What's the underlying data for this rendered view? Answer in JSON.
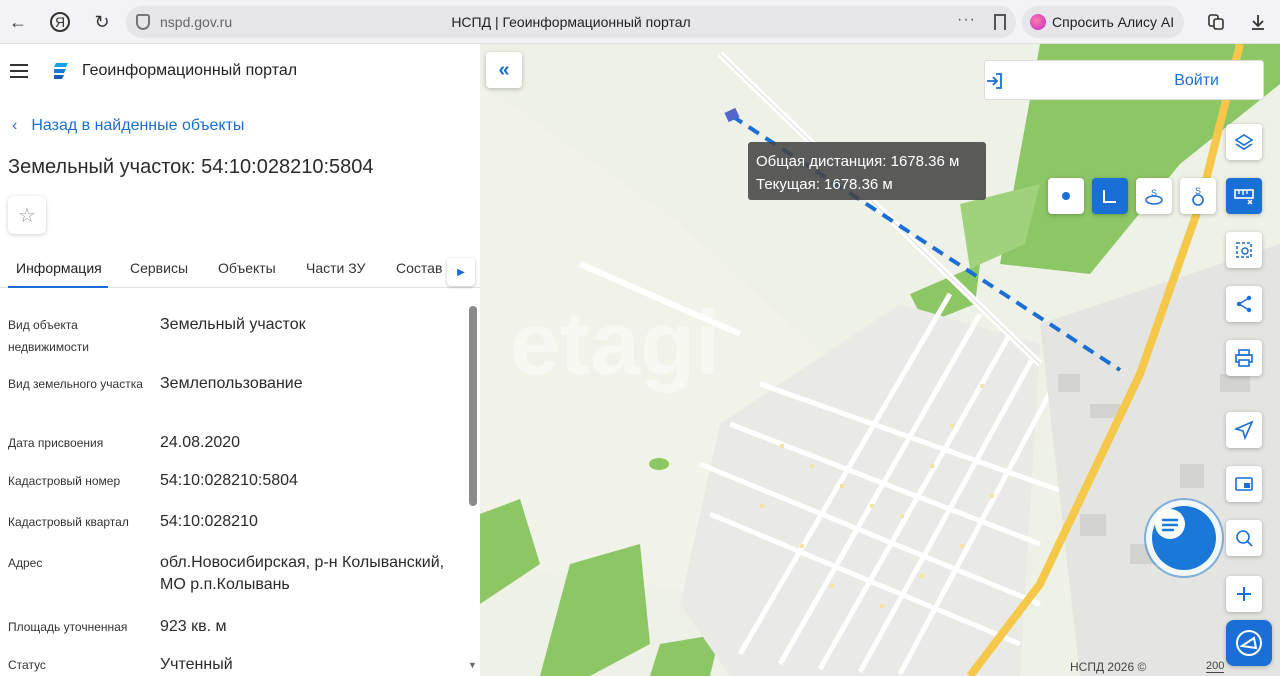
{
  "browser": {
    "host": "nspd.gov.ru",
    "page_title": "НСПД | Геоинформационный портал",
    "alice_label": "Спросить Алису AI",
    "dots": "···"
  },
  "panel": {
    "portal_name": "Геоинформационный портал",
    "back_label": "Назад в найденные объекты",
    "object_title": "Земельный участок: 54:10:028210:5804",
    "tabs": [
      "Информация",
      "Сервисы",
      "Объекты",
      "Части ЗУ",
      "Состав"
    ],
    "fields": [
      {
        "label": "Вид объекта недвижимости",
        "value": "Земельный участок"
      },
      {
        "label": "Вид земельного участка",
        "value": "Землепользование"
      },
      {
        "label": "Дата присвоения",
        "value": "24.08.2020"
      },
      {
        "label": "Кадастровый номер",
        "value": "54:10:028210:5804"
      },
      {
        "label": "Кадастровый квартал",
        "value": "54:10:028210"
      },
      {
        "label": "Адрес",
        "value": "обл.Новосибирская, р-н Колыванский, МО р.п.Колывань"
      },
      {
        "label": "Площадь уточненная",
        "value": "923 кв. м"
      },
      {
        "label": "Статус",
        "value": "Учтенный"
      }
    ]
  },
  "map": {
    "login_label": "Войти",
    "tooltip": {
      "total": "Общая дистанция: 1678.36 м",
      "current": "Текущая: 1678.36 м"
    },
    "footer": "НСПД 2026 ©",
    "scale": "200",
    "colors": {
      "accent": "#1a6fd6",
      "forest": "#8cc665",
      "road_major": "#f5c84a",
      "measure_line": "#1a6fd6"
    }
  }
}
